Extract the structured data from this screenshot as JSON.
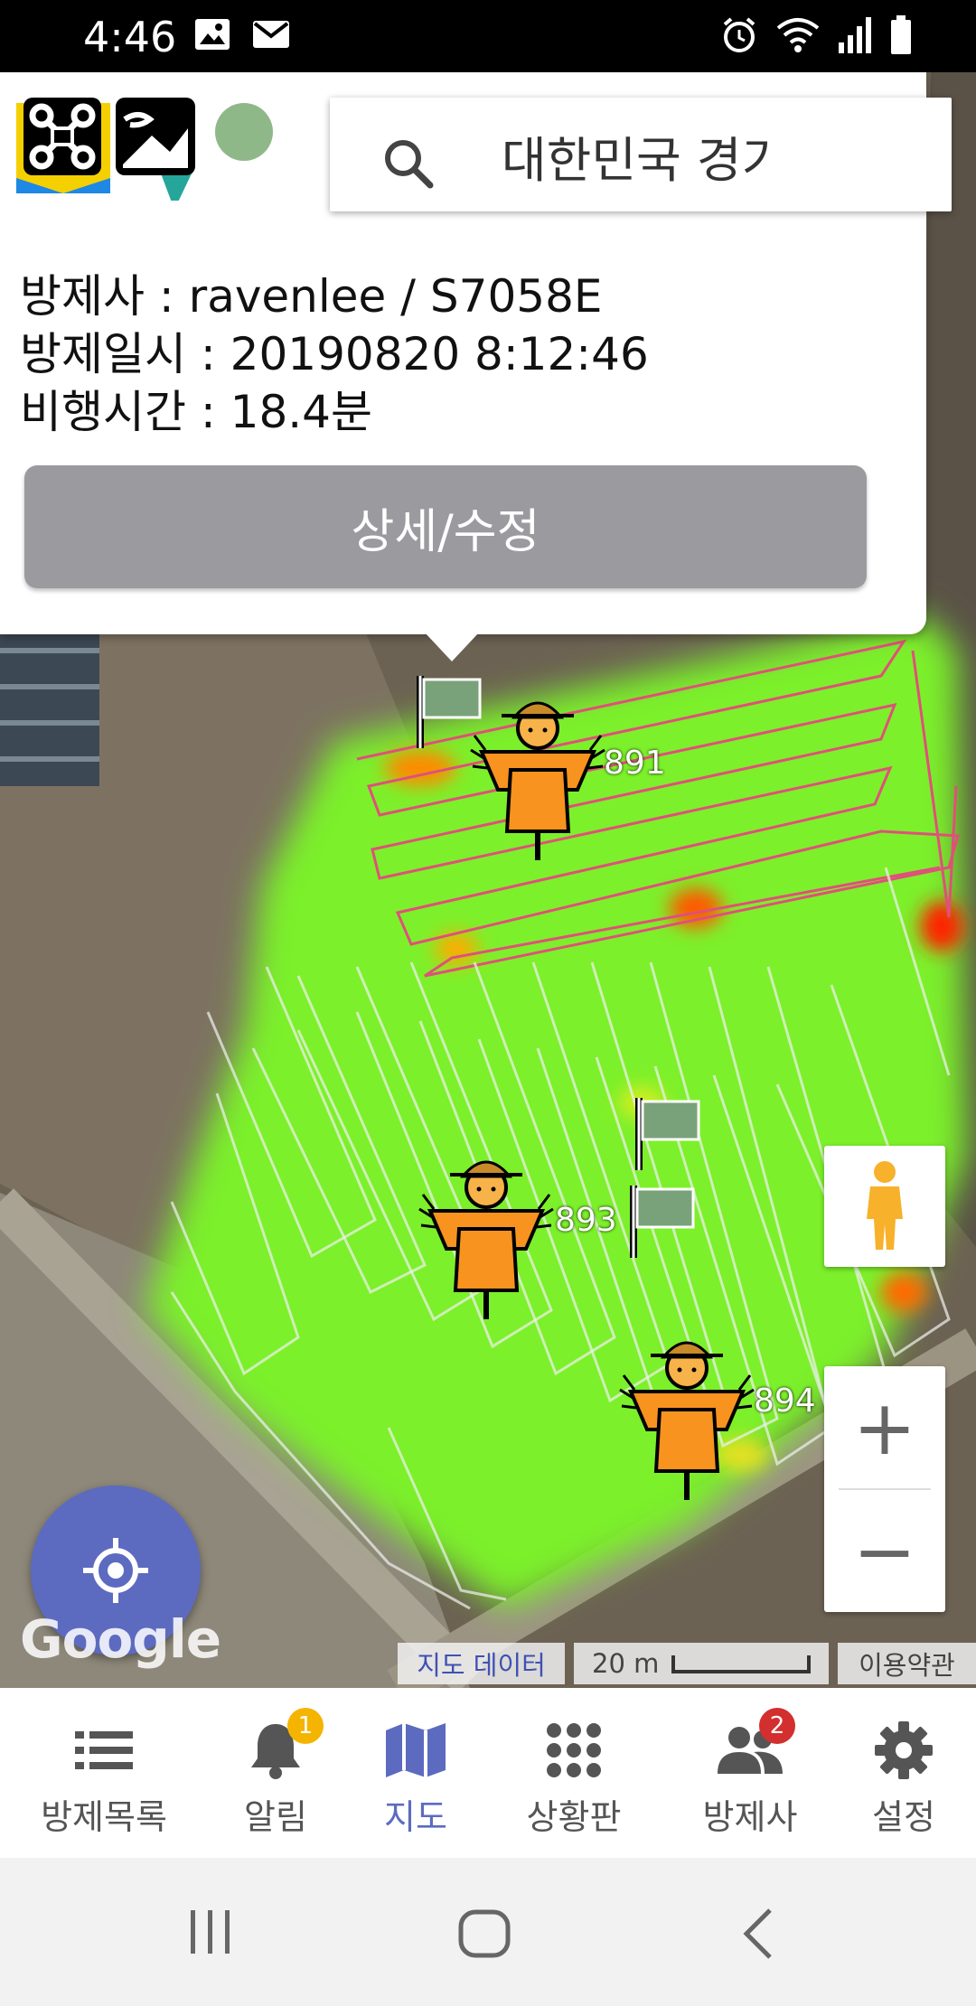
{
  "status_bar": {
    "time": "4:46"
  },
  "search": {
    "value": "대한민국 경기"
  },
  "info": {
    "operator": "방제사 : ravenlee / S7058E",
    "datetime": "방제일시 : 20190820 8:12:46",
    "flight_time": "비행시간 : 18.4분",
    "detail_button": "상세/수정"
  },
  "markers": [
    {
      "label": "891"
    },
    {
      "label": "893"
    },
    {
      "label": "894"
    }
  ],
  "map_attribution": {
    "data": "지도 데이터",
    "scale": "20 m",
    "terms": "이용약관",
    "logo": "Google"
  },
  "zoom": {
    "in": "+",
    "out": "−"
  },
  "bottom_nav": {
    "items": [
      {
        "label": "방제목록",
        "icon": "list-icon"
      },
      {
        "label": "알림",
        "icon": "bell-icon",
        "badge": "1"
      },
      {
        "label": "지도",
        "icon": "map-icon"
      },
      {
        "label": "상황판",
        "icon": "grid-icon"
      },
      {
        "label": "방제사",
        "icon": "people-icon",
        "badge": "2"
      },
      {
        "label": "설정",
        "icon": "gear-icon"
      }
    ],
    "active": "지도"
  },
  "colors": {
    "accent": "#5c6bc0",
    "heat": "#7cf02a",
    "track": "#e0507a",
    "badge_yellow": "#f5b400",
    "badge_red": "#d32f2f"
  }
}
